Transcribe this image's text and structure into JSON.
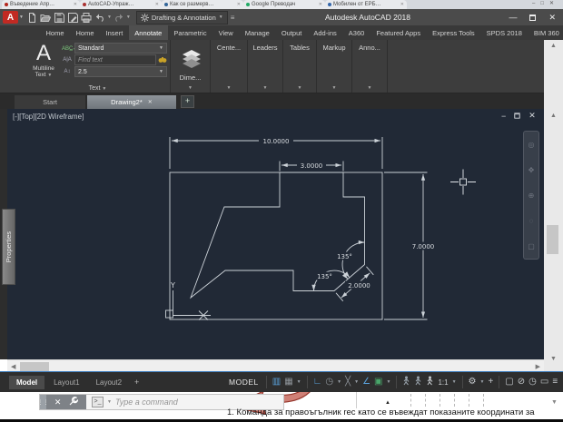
{
  "browser": {
    "tabs": [
      "Въведение Апр…",
      "AutoCAD-Упраж…",
      "Как се размерв…",
      "Google Преводач",
      "Мобилен от ЕРБ…"
    ],
    "window_controls": {
      "minimize": "–",
      "maximize": "□",
      "close": "✕"
    }
  },
  "titlebar": {
    "logo": "A",
    "workspace": "Drafting & Annotation",
    "title": "Autodesk AutoCAD 2018",
    "minimize": "—",
    "close": "✕"
  },
  "ribbon": {
    "tabs": [
      "Home",
      "Home",
      "Insert",
      "Annotate",
      "Parametric",
      "View",
      "Manage",
      "Output",
      "Add-ins",
      "A360",
      "Featured Apps",
      "Express Tools",
      "SPDS 2018",
      "BIM 360"
    ],
    "text_panel": {
      "button_line1": "Multiline",
      "button_line2": "Text",
      "style_value": "Standard",
      "find_placeholder": "Find text",
      "height_value": "2.5",
      "panel_label": "Text"
    },
    "collapsed_panels": [
      "Dime...",
      "Cente...",
      "Leaders",
      "Tables",
      "Markup",
      "Anno..."
    ]
  },
  "file_tabs": {
    "start": "Start",
    "drawing": "Drawing2*",
    "new": "+"
  },
  "viewport": {
    "label": "[-][Top][2D Wireframe]",
    "properties_tab": "Properties"
  },
  "drawing": {
    "dim_width": "10.0000",
    "dim_tab": "3.0000",
    "dim_height": "7.0000",
    "dim_aligned": "2.0000",
    "angle_upper": "135°",
    "angle_lower": "135°",
    "ucs_y": "Y",
    "ucs_x": "X"
  },
  "layout_tabs": {
    "model": "Model",
    "layout1": "Layout1",
    "layout2": "Layout2",
    "new": "+"
  },
  "statusbar": {
    "model_label": "MODEL",
    "scale": "1:1"
  },
  "command_line": {
    "placeholder": "Type a command"
  },
  "document": {
    "caption": "1. Команда за правоъгълник rec като се въвеждат показаните координати за"
  }
}
